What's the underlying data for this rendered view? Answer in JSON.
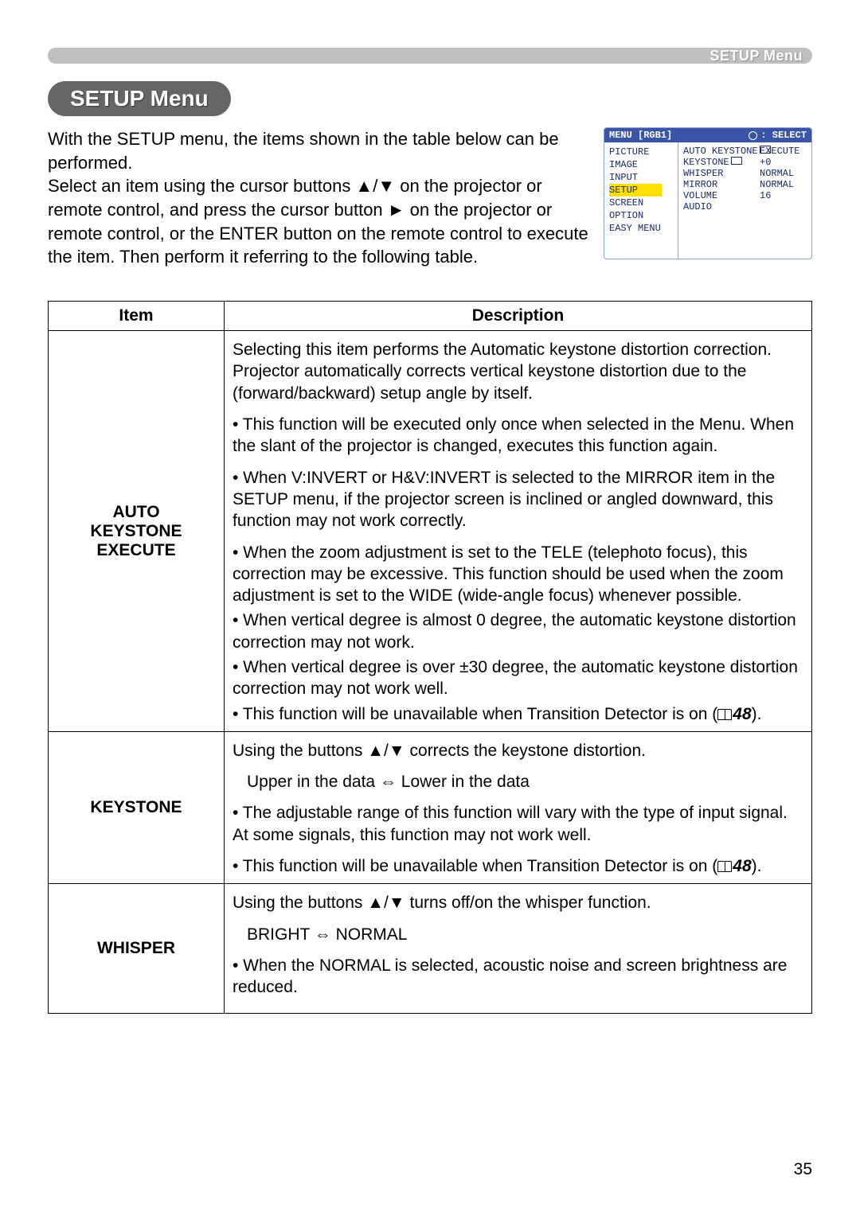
{
  "header": {
    "right_label": "SETUP Menu"
  },
  "title": "SETUP Menu",
  "intro": {
    "p1": "With the SETUP menu, the items shown in the table below can be performed.",
    "p2": "Select an item using the cursor buttons ▲/▼ on the projector or remote control, and press the cursor button ► on the projector or remote control, or the ENTER button on the remote control to execute the item. Then perform it referring to the following table."
  },
  "osd": {
    "menu_label": "MENU [RGB1]",
    "select_label": ": SELECT",
    "left_items": [
      "PICTURE",
      "IMAGE",
      "INPUT",
      "SETUP",
      "SCREEN",
      "OPTION",
      "EASY MENU"
    ],
    "highlight_index": 3,
    "right_rows": [
      {
        "label": "AUTO KEYSTONE",
        "icon": "▢",
        "value": "EXECUTE"
      },
      {
        "label": "KEYSTONE",
        "icon": "▢",
        "value": "+0"
      },
      {
        "label": "WHISPER",
        "icon": "",
        "value": "NORMAL"
      },
      {
        "label": "MIRROR",
        "icon": "",
        "value": "NORMAL"
      },
      {
        "label": "VOLUME",
        "icon": "",
        "value": "16"
      },
      {
        "label": "AUDIO",
        "icon": "",
        "value": ""
      }
    ]
  },
  "table": {
    "head_item": "Item",
    "head_desc": "Description",
    "rows": [
      {
        "item": "AUTO KEYSTONE EXECUTE",
        "desc": {
          "p1": "Selecting this item performs the Automatic keystone distortion correction. Projector automatically corrects vertical keystone distortion due to the (forward/backward) setup angle by itself.",
          "p2": "• This function will be executed only once when selected in the Menu. When the slant of the projector is changed, executes this function again.",
          "p3": "• When V:INVERT or H&V:INVERT is selected to the MIRROR item in the SETUP menu, if the projector screen is inclined or angled downward, this function may not work correctly.",
          "p4": "• When the zoom adjustment is set to the TELE (telephoto focus), this correction may be excessive. This function should be used when the zoom adjustment is set to the WIDE (wide-angle focus) whenever possible.",
          "p5": "• When vertical degree is almost 0 degree, the automatic keystone distortion correction may not work.",
          "p6": "• When vertical degree is over ±30 degree, the automatic keystone distortion correction may not work well.",
          "p7_pre": "• This function will be unavailable when Transition Detector is on (",
          "p7_ref": "48",
          "p7_post": ")."
        }
      },
      {
        "item": "KEYSTONE",
        "desc": {
          "p1": "Using the buttons ▲/▼ corrects the keystone distortion.",
          "p2": "Upper in the data ⇔ Lower in the data",
          "p3": "• The adjustable range of this function will vary with the type of input signal. At some signals, this function may not work well.",
          "p4_pre": "• This function will be unavailable when Transition Detector is on (",
          "p4_ref": "48",
          "p4_post": ")."
        }
      },
      {
        "item": "WHISPER",
        "desc": {
          "p1": "Using the buttons ▲/▼ turns off/on the whisper function.",
          "p2": "BRIGHT ⇔ NORMAL",
          "p3": "• When the NORMAL is selected, acoustic noise and screen brightness are reduced."
        }
      }
    ]
  },
  "page_number": "35"
}
